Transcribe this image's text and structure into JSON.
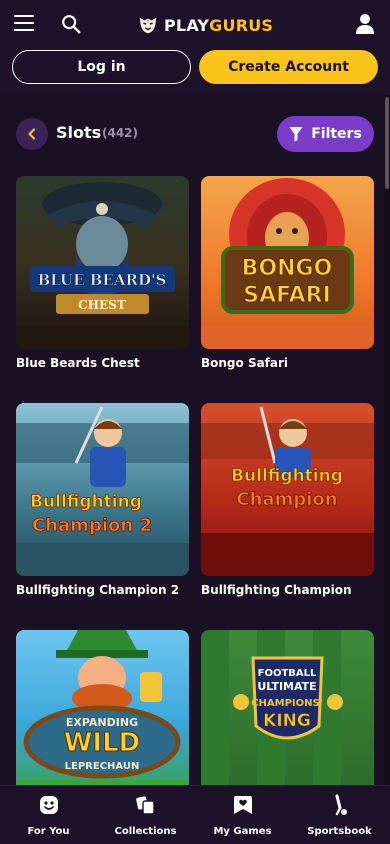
{
  "header": {
    "logo_text_a": "PLAY",
    "logo_text_b": "GURUS",
    "icons": [
      "hamburger-icon",
      "search-icon",
      "user-icon"
    ]
  },
  "auth": {
    "login_label": "Log in",
    "create_label": "Create Account"
  },
  "section": {
    "title": "Slots",
    "count": "(442)",
    "filters_label": "Filters"
  },
  "games": [
    {
      "title": "Blue Beards Chest",
      "art_text": [
        "BLUE BEARD'S",
        "CHEST"
      ]
    },
    {
      "title": "Bongo Safari",
      "art_text": [
        "BONGO",
        "SAFARI"
      ]
    },
    {
      "title": "Bullfighting Champion 2",
      "art_text": [
        "Bullfighting",
        "Champion 2"
      ]
    },
    {
      "title": "Bullfighting Champion",
      "art_text": [
        "Bullfighting",
        "Champion"
      ]
    },
    {
      "title": "Expanding Wild Leprechaun",
      "art_text": [
        "EXPANDING",
        "WILD",
        "LEPRECHAUN"
      ]
    },
    {
      "title": "Football Ultimate Champions' King",
      "art_text": [
        "FOOTBALL",
        "ULTIMATE",
        "CHAMPIONS'",
        "KING"
      ]
    }
  ],
  "bottom_nav": [
    {
      "label": "For You",
      "icon": "smile-icon"
    },
    {
      "label": "Collections",
      "icon": "collections-icon"
    },
    {
      "label": "My Games",
      "icon": "heart-icon"
    },
    {
      "label": "Sportsbook",
      "icon": "sportsbook-icon"
    }
  ],
  "colors": {
    "background": "#1a1124",
    "accent_yellow": "#fcc41a",
    "accent_purple": "#7b3dc8"
  }
}
